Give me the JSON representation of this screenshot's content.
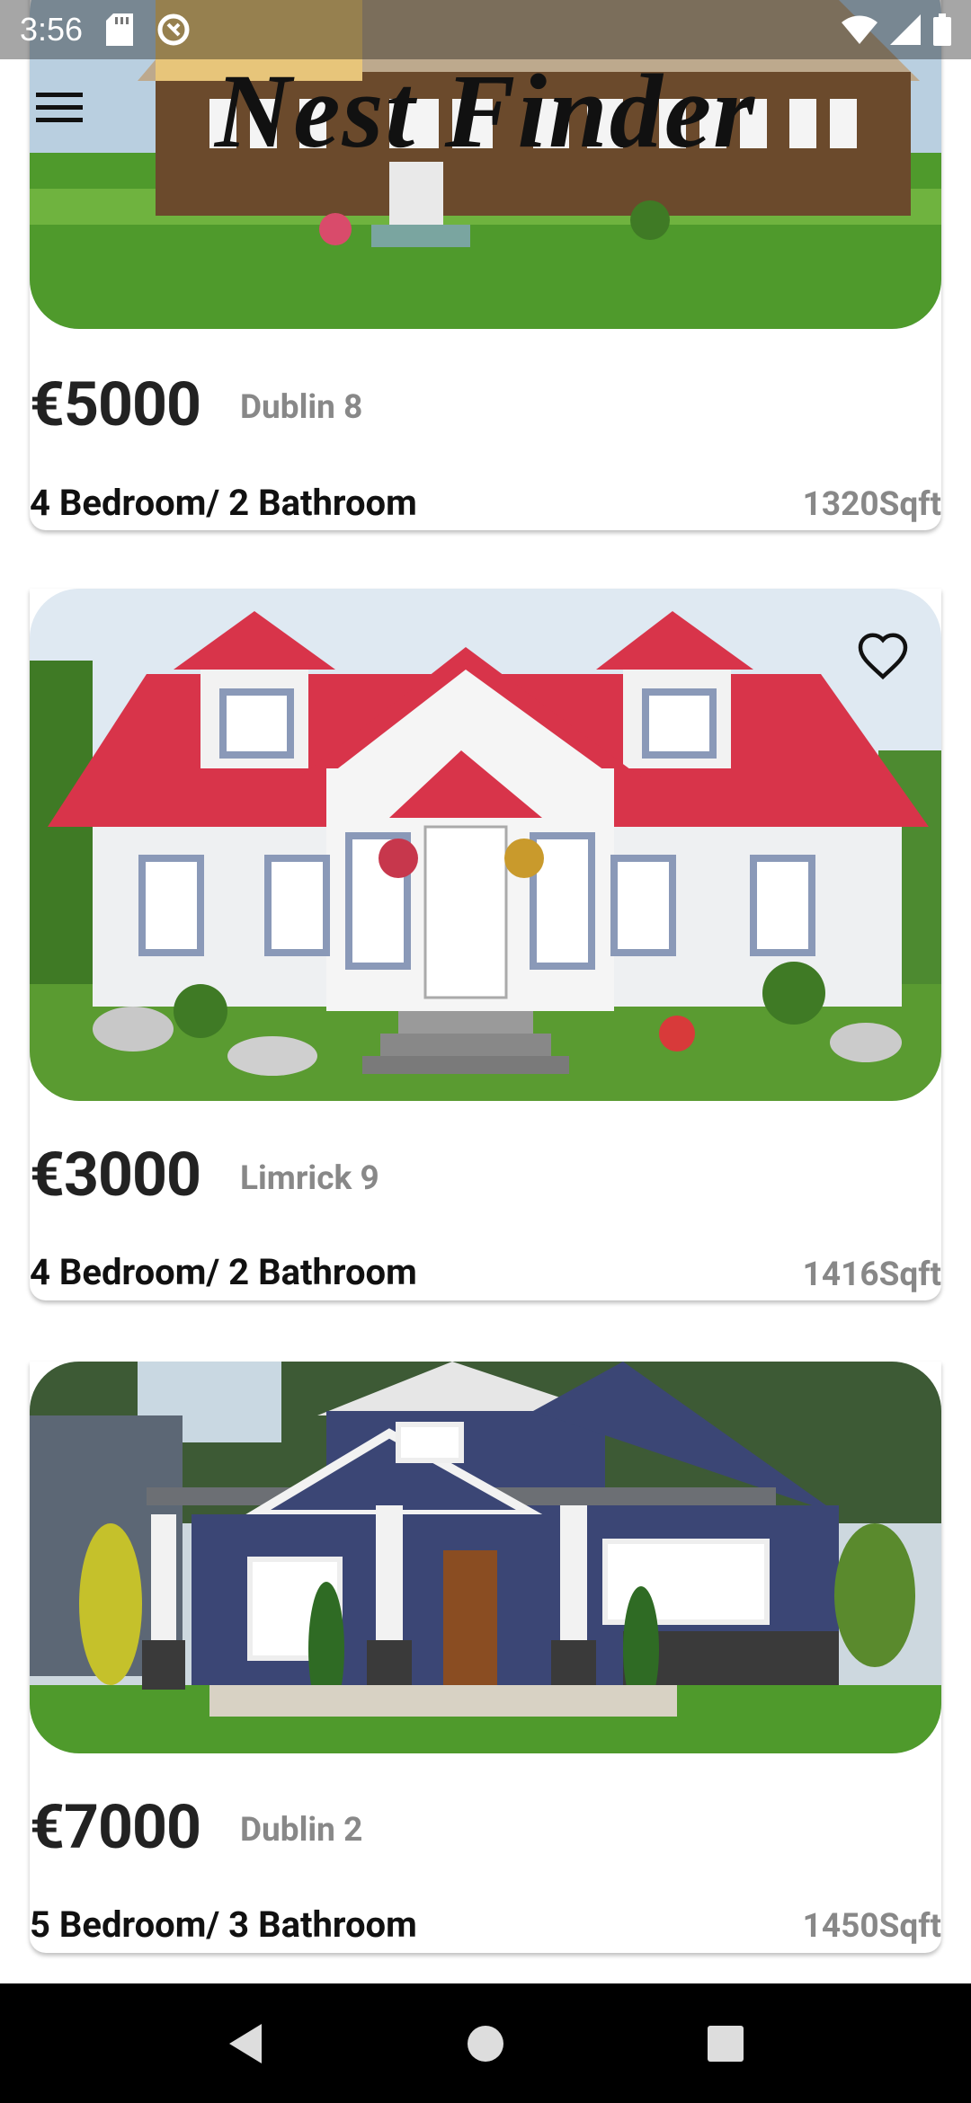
{
  "status_bar": {
    "time": "3:56"
  },
  "app": {
    "title": "Nest Finder"
  },
  "listings": [
    {
      "price": "€5000",
      "location": "Dublin 8",
      "rooms": "4 Bedroom/ 2 Bathroom",
      "area": "1320Sqft"
    },
    {
      "price": "€3000",
      "location": "Limrick 9",
      "rooms": "4 Bedroom/ 2 Bathroom",
      "area": "1416Sqft"
    },
    {
      "price": "€7000",
      "location": "Dublin 2",
      "rooms": "5 Bedroom/ 3 Bathroom",
      "area": "1450Sqft"
    }
  ],
  "colors": {
    "roof_red": "#d8344a",
    "siding_navy": "#3b4675",
    "lawn_green": "#4f9a2c"
  }
}
